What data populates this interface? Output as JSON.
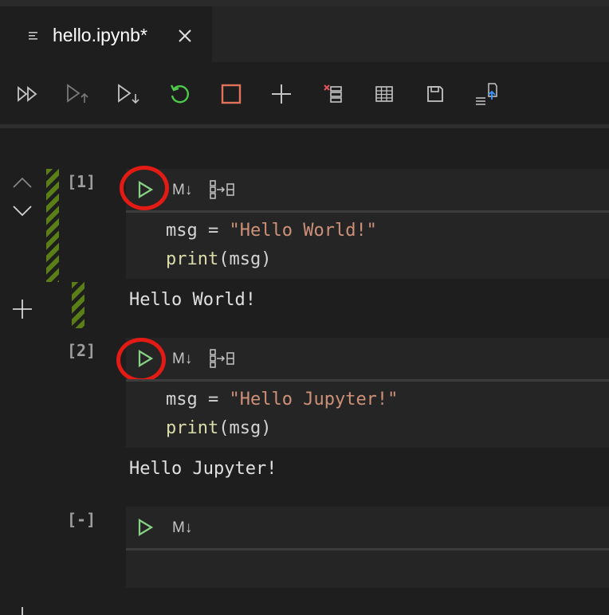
{
  "tab": {
    "title": "hello.ipynb*"
  },
  "toolbar": {
    "buttons": [
      "run-all",
      "run-above",
      "run-below",
      "restart-kernel",
      "interrupt-kernel",
      "add-cell",
      "clear-outputs",
      "variable-explorer",
      "save",
      "export"
    ]
  },
  "cells": [
    {
      "exec_count": "[1]",
      "markdown_label": "M↓",
      "code": {
        "line1_var": "msg",
        "line1_op": " = ",
        "line1_str": "\"Hello World!\"",
        "line2_fn": "print",
        "line2_args": "(msg)"
      },
      "output": "Hello World!"
    },
    {
      "exec_count": "[2]",
      "markdown_label": "M↓",
      "code": {
        "line1_var": "msg",
        "line1_op": " = ",
        "line1_str": "\"Hello Jupyter!\"",
        "line2_fn": "print",
        "line2_args": "(msg)"
      },
      "output": "Hello Jupyter!"
    },
    {
      "exec_count": "[-]",
      "markdown_label": "M↓"
    }
  ],
  "colors": {
    "run_green": "#89d185",
    "restart_green": "#4ec94b",
    "interrupt_red": "#e2735a",
    "highlight_red": "#e31b14",
    "cell_stripe": "#5b7f17"
  }
}
